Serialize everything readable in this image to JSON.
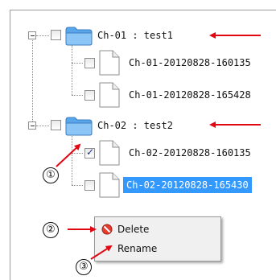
{
  "tree": {
    "nodes": [
      {
        "label": "Ch-01 : test1",
        "checked": false,
        "selected": false
      },
      {
        "label": "Ch-01-20120828-160135",
        "checked": false,
        "selected": false
      },
      {
        "label": "Ch-01-20120828-165428",
        "checked": false,
        "selected": false
      },
      {
        "label": "Ch-02 : test2",
        "checked": false,
        "selected": false
      },
      {
        "label": "Ch-02-20120828-160135",
        "checked": true,
        "selected": false
      },
      {
        "label": "Ch-02-20120828-165430",
        "checked": false,
        "selected": true
      }
    ]
  },
  "context_menu": {
    "delete_label": "Delete",
    "rename_label": "Rename"
  },
  "callouts": {
    "one": "①",
    "two": "②",
    "three": "③"
  },
  "icons": {
    "folder": "folder-icon",
    "file": "file-icon",
    "delete": "delete-icon",
    "expander": "collapse-icon"
  },
  "colors": {
    "selection": "#3399ff",
    "arrow": "#e30613",
    "folder": "#6fb3ef"
  }
}
